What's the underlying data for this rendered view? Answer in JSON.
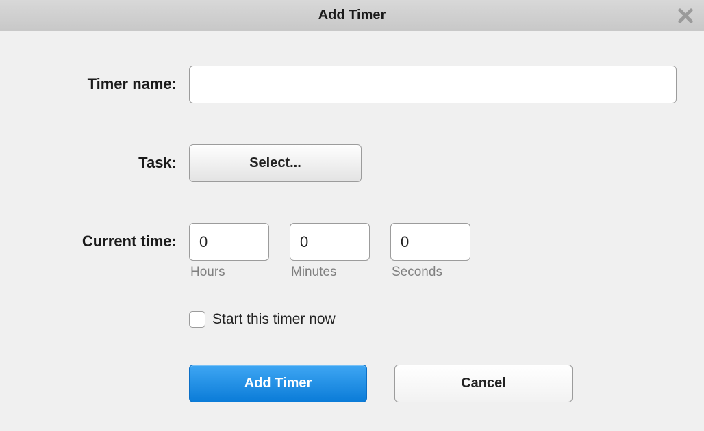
{
  "dialog": {
    "title": "Add Timer",
    "closeLabel": "Close"
  },
  "form": {
    "timerName": {
      "label": "Timer name:",
      "value": ""
    },
    "task": {
      "label": "Task:",
      "buttonLabel": "Select..."
    },
    "currentTime": {
      "label": "Current time:",
      "hours": {
        "value": "0",
        "sublabel": "Hours"
      },
      "minutes": {
        "value": "0",
        "sublabel": "Minutes"
      },
      "seconds": {
        "value": "0",
        "sublabel": "Seconds"
      }
    },
    "startNow": {
      "label": "Start this timer now",
      "checked": false
    },
    "actions": {
      "submit": "Add Timer",
      "cancel": "Cancel"
    }
  }
}
